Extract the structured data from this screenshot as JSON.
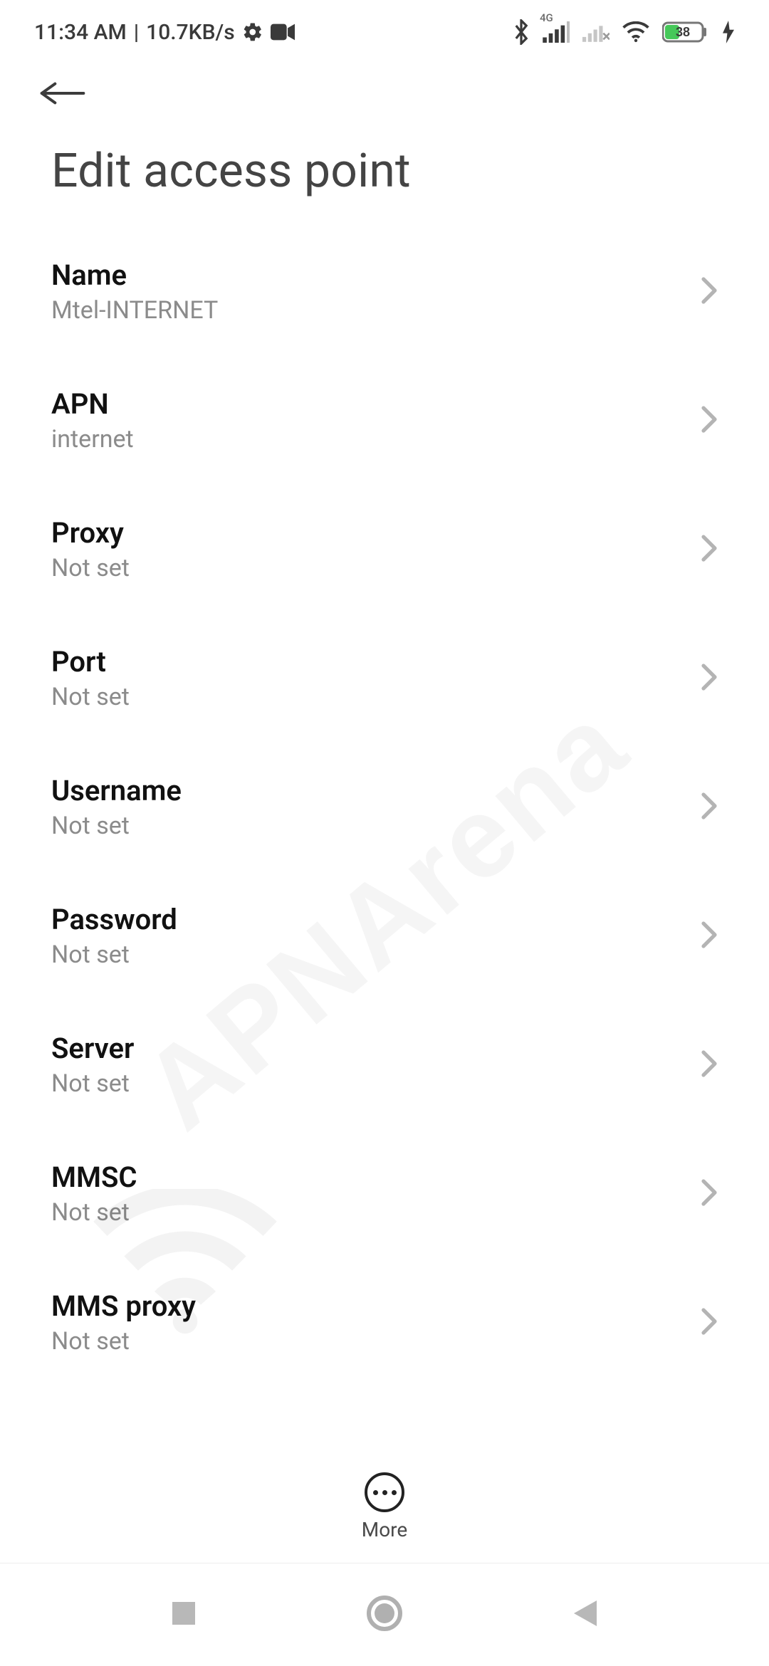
{
  "status": {
    "time": "11:34 AM",
    "speed": "10.7KB/s",
    "network_badge": "4G",
    "battery_pct": "38"
  },
  "page_title": "Edit access point",
  "items": [
    {
      "label": "Name",
      "value": "Mtel-INTERNET"
    },
    {
      "label": "APN",
      "value": "internet"
    },
    {
      "label": "Proxy",
      "value": "Not set"
    },
    {
      "label": "Port",
      "value": "Not set"
    },
    {
      "label": "Username",
      "value": "Not set"
    },
    {
      "label": "Password",
      "value": "Not set"
    },
    {
      "label": "Server",
      "value": "Not set"
    },
    {
      "label": "MMSC",
      "value": "Not set"
    },
    {
      "label": "MMS proxy",
      "value": "Not set"
    }
  ],
  "more_label": "More",
  "watermark": "APNArena"
}
